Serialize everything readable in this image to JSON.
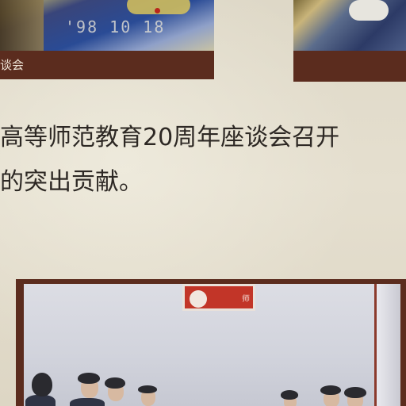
{
  "photos": {
    "top_left": {
      "date_stamp": "'98 10 18",
      "caption": "谈会"
    },
    "bottom": {
      "banner_text": "师"
    }
  },
  "article": {
    "line1": "高等师范教育20周年座谈会召开",
    "line2": "的突出贡献。"
  }
}
